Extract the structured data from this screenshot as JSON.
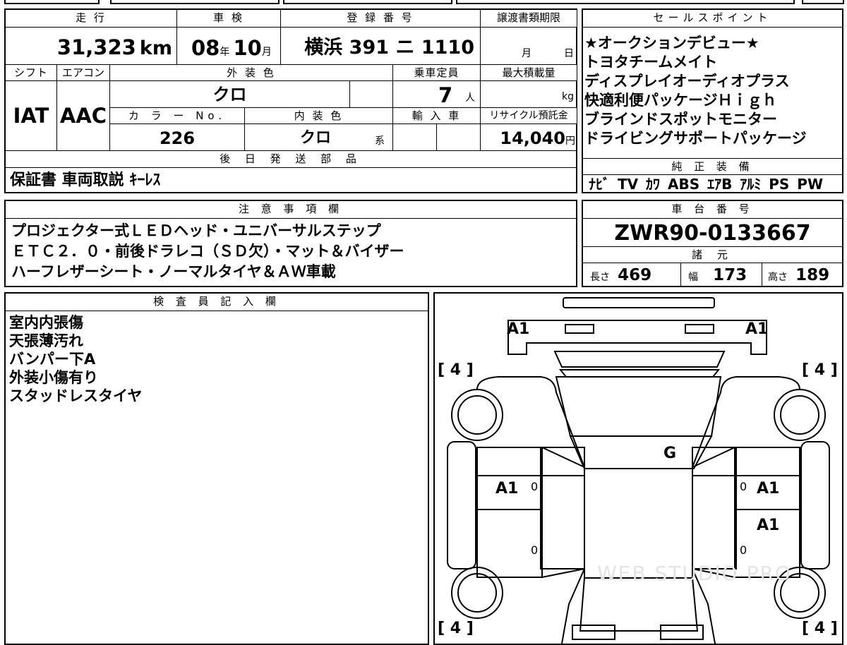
{
  "main_table": {
    "mileage_label": "走 行",
    "mileage_value": "31,323",
    "mileage_unit": "km",
    "inspection_label": "車 検",
    "inspection_year": "08",
    "inspection_year_unit": "年",
    "inspection_month": "10",
    "inspection_month_unit": "月",
    "registration_label": "登 録 番 号",
    "registration_value": "横浜 391 ニ 1110",
    "transfer_label": "譲渡書類期限",
    "transfer_month_unit": "月",
    "transfer_day_unit": "日",
    "shift_label": "シフト",
    "shift_value": "IAT",
    "aircon_label": "エアコン",
    "aircon_value": "AAC",
    "exterior_color_label": "外 装 色",
    "exterior_color_value": "クロ",
    "capacity_label": "乗車定員",
    "capacity_value": "7",
    "capacity_unit": "人",
    "max_load_label": "最大積載量",
    "max_load_unit": "kg",
    "color_no_label": "カ ラ ー No.",
    "color_no_value": "226",
    "interior_color_label": "内 装 色",
    "interior_color_value": "クロ",
    "interior_color_unit": "系",
    "import_label": "輸 入 車",
    "recycle_label": "リサイクル預託金",
    "recycle_value": "14,040",
    "recycle_unit": "円",
    "later_parts_label": "後 日 発 送 部 品",
    "later_parts_value": "保証書 車両取説 ｷｰﾚｽ"
  },
  "sales_points": {
    "label": "セールスポイント",
    "lines": [
      "★オークションデビュー★",
      "トヨタチームメイト",
      "ディスプレイオーディオプラス",
      "快適利便パッケージＨｉｇｈ",
      "ブラインドスポットモニター",
      "ドライビングサポートパッケージ"
    ]
  },
  "genuine_equipment": {
    "label": "純 正 装 備",
    "value": "ﾅﾋﾞ TV ｶﾜ ABS ｴｱB ｱﾙﾐ PS PW"
  },
  "notes": {
    "label": "注 意 事 項 欄",
    "lines": [
      "プロジェクター式ＬＥＤヘッド・ユニバーサルステップ",
      "ＥＴＣ２．０・前後ドラレコ（ＳＤ欠）・マット＆バイザー",
      "ハーフレザーシート・ノーマルタイヤ＆ＡＷ車載"
    ]
  },
  "chassis": {
    "label": "車 台 番 号",
    "value": "ZWR90-0133667"
  },
  "specs": {
    "label": "諸 元",
    "length_label": "長さ",
    "length_value": "469",
    "width_label": "幅",
    "width_value": "173",
    "height_label": "高さ",
    "height_value": "189"
  },
  "inspector": {
    "label": "検 査 員 記 入 欄",
    "lines": [
      "室内内張傷",
      "天張薄汚れ",
      "バンパー下A",
      "外装小傷有り",
      "スタッドレスタイヤ"
    ]
  },
  "diagram": {
    "tire_front_left": "4",
    "tire_front_right": "4",
    "tire_rear_left": "4",
    "tire_rear_right": "4",
    "front_left_mark": "A1",
    "front_right_mark": "A1",
    "roof_mark": "G",
    "left_front_door_mark": "A1",
    "right_front_door_mark": "A1",
    "right_rear_door_mark": "A1",
    "zero_marks": [
      "0",
      "0",
      "0",
      "0"
    ],
    "watermark": "WEB STUDIO PRO"
  }
}
